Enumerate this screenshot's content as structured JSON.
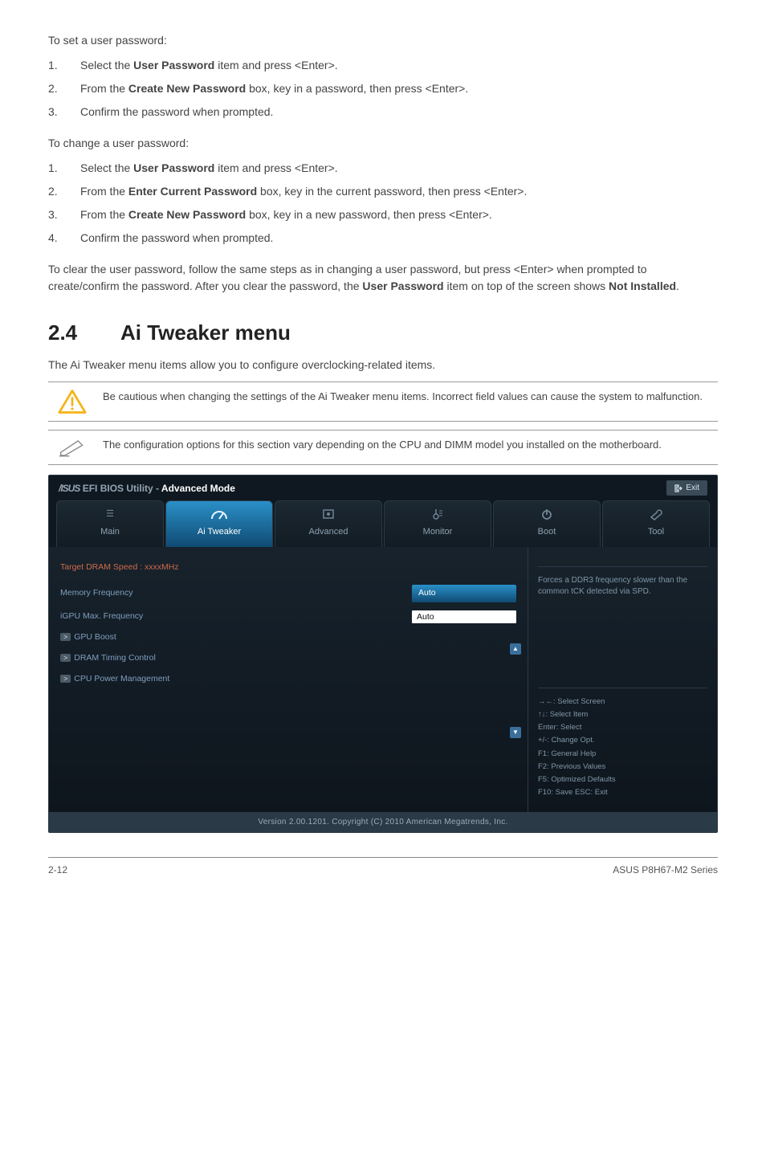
{
  "top": {
    "intro1": "To set a user password:",
    "steps1": [
      {
        "n": "1.",
        "pre": "Select the ",
        "b": "User Password",
        "post": " item and press <Enter>."
      },
      {
        "n": "2.",
        "pre": "From the ",
        "b": "Create New Password",
        "post": " box, key in a password, then press <Enter>."
      },
      {
        "n": "3.",
        "pre": "Confirm the password when prompted.",
        "b": "",
        "post": ""
      }
    ],
    "intro2": "To change a user password:",
    "steps2": [
      {
        "n": "1.",
        "pre": "Select the ",
        "b": "User Password",
        "post": " item and press <Enter>."
      },
      {
        "n": "2.",
        "pre": "From the ",
        "b": "Enter Current Password",
        "post": " box, key in the current password, then press <Enter>."
      },
      {
        "n": "3.",
        "pre": "From the ",
        "b": "Create New Password",
        "post": " box, key in a new password, then press <Enter>."
      },
      {
        "n": "4.",
        "pre": "Confirm the password when prompted.",
        "b": "",
        "post": ""
      }
    ],
    "clear_a": "To clear the user password, follow the same steps as in changing a user password, but press <Enter> when prompted to create/confirm the password. After you clear the password, the ",
    "clear_b": "User Password",
    "clear_c": " item on top of the screen shows ",
    "clear_d": "Not Installed",
    "clear_e": "."
  },
  "section": {
    "num": "2.4",
    "title": "Ai Tweaker menu",
    "lead": "The Ai Tweaker menu items allow you to configure overclocking-related items."
  },
  "callouts": {
    "caution": "Be cautious when changing the settings of the Ai Tweaker menu items. Incorrect field values can cause the system to malfunction.",
    "note": "The configuration options for this section vary depending on the CPU and DIMM model you installed on the motherboard."
  },
  "bios": {
    "brand_white": "EFI BIOS Utility - ",
    "brand_accent": "Advanced Mode",
    "exit": "Exit",
    "tabs": [
      {
        "label": "Main"
      },
      {
        "label": "Ai  Tweaker"
      },
      {
        "label": "Advanced"
      },
      {
        "label": "Monitor"
      },
      {
        "label": "Boot"
      },
      {
        "label": "Tool"
      }
    ],
    "left": {
      "target": "Target DRAM Speed :  xxxxMHz",
      "memfreq_label": "Memory Frequency",
      "memfreq_val": "Auto",
      "igpu_label": "iGPU Max. Frequency",
      "igpu_val": "Auto",
      "items": [
        "GPU Boost",
        "DRAM Timing Control",
        "CPU Power Management"
      ]
    },
    "right": {
      "help": "Forces a DDR3 frequency slower than the common tCK detected via SPD.",
      "keys": [
        "→←: Select Screen",
        "↑↓: Select Item",
        "Enter: Select",
        "+/-: Change Opt.",
        "F1: General Help",
        "F2: Previous Values",
        "F5: Optimized Defaults",
        "F10: Save   ESC: Exit"
      ]
    },
    "footer": "Version 2.00.1201.   Copyright (C) 2010 American Megatrends, Inc."
  },
  "pagefoot": {
    "left": "2-12",
    "right": "ASUS P8H67-M2 Series"
  }
}
